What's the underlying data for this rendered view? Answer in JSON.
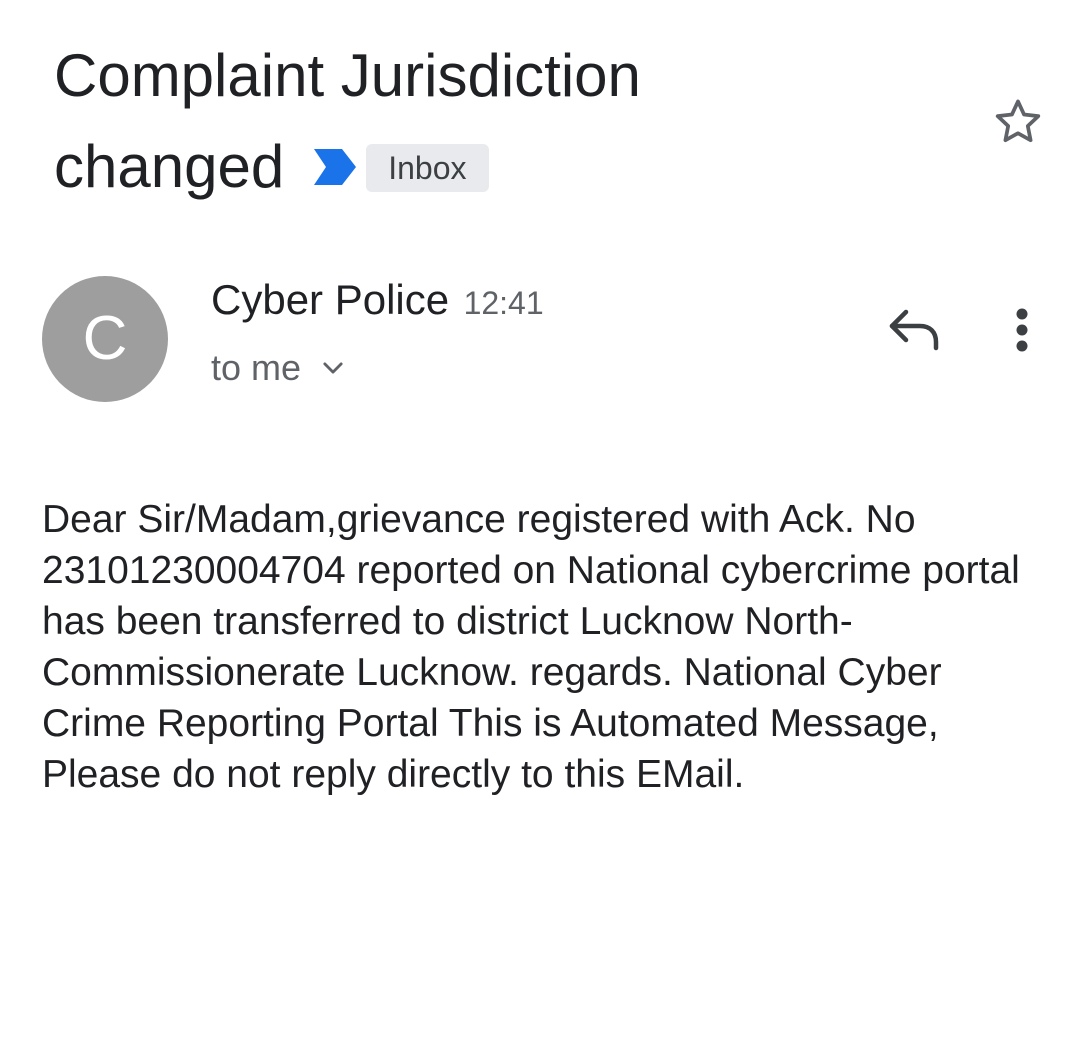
{
  "message": {
    "subject_line_1": "Complaint Jurisdiction",
    "subject_line_2": "changed",
    "label": "Inbox",
    "sender": {
      "avatar_initial": "C",
      "name": "Cyber Police",
      "time": "12:41",
      "recipient": "to me"
    },
    "body": "Dear Sir/Madam,grievance registered with Ack. No 23101230004704 reported on National cybercrime portal has been transferred to district Lucknow North- Commissionerate Lucknow. regards. National Cyber Crime Reporting Portal This is Automated Message, Please do not reply directly to this EMail."
  },
  "icons": {
    "importance": "importance-marker-icon",
    "star": "star-outline-icon",
    "recipient_expand": "chevron-down-icon",
    "reply": "reply-icon",
    "more": "more-vert-icon"
  },
  "colors": {
    "importance_marker": "#1a73e8",
    "label_background": "#e8eaed",
    "avatar_background": "#9e9e9e",
    "icon": "#5f6368"
  }
}
